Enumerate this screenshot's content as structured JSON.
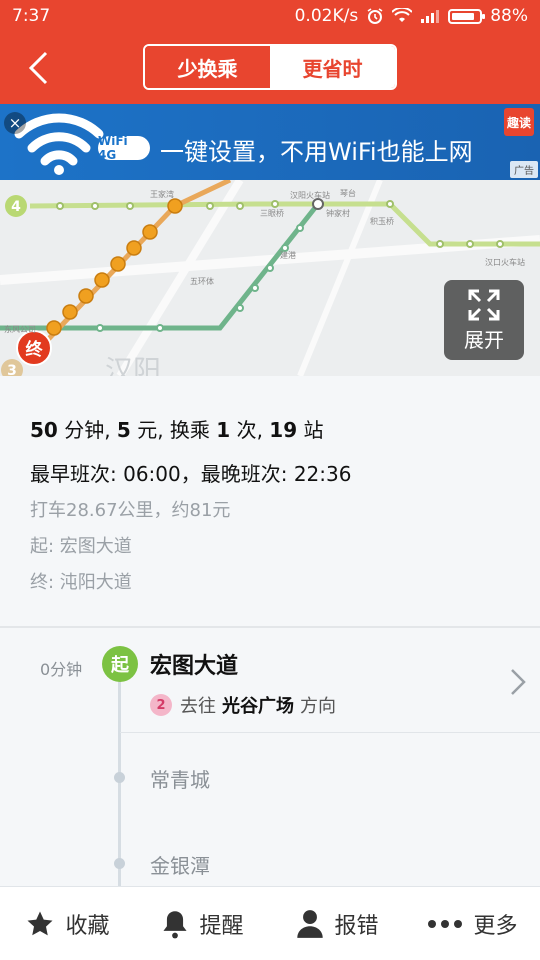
{
  "status_bar": {
    "time": "7:37",
    "speed": "0.02K/s",
    "battery": "88%"
  },
  "header": {
    "tabs": [
      {
        "label": "少换乘",
        "active": true
      },
      {
        "label": "更省时",
        "active": false
      }
    ]
  },
  "ad": {
    "close": "×",
    "pill": "WiFi 4G",
    "text": "一键设置，不用WiFi也能上网",
    "logo": "趣读",
    "tag": "广告"
  },
  "map": {
    "expand_label": "展开",
    "end_badge": "终",
    "line_labels": {
      "line4": "4",
      "line3": "3"
    },
    "stations": [
      "王家湾",
      "汉阳火车站",
      "钟家村",
      "琴台",
      "三眼桥",
      "汉口火车站",
      "东风公司",
      "五环体",
      "建港",
      "积玉桥",
      "展开"
    ],
    "district": "汉阳"
  },
  "summary": {
    "time": "50",
    "time_unit": "分钟",
    "fare": "5",
    "fare_unit": "元",
    "transfer_label": "换乘",
    "transfers": "1",
    "transfer_unit": "次",
    "stations": "19",
    "stations_unit": "站",
    "first_last": "最早班次: 06:00，最晚班次: 22:36",
    "taxi": "打车28.67公里，约81元",
    "start": "起: 宏图大道",
    "end": "终: 沌阳大道"
  },
  "route": {
    "start_time": "0分钟",
    "start_badge": "起",
    "start_station": "宏图大道",
    "line_number": "2",
    "toward_prefix": "去往",
    "toward_station": "光谷广场",
    "toward_suffix": "方向",
    "stops": [
      "常青城",
      "金银潭"
    ]
  },
  "bottom_bar": {
    "favorite": "收藏",
    "remind": "提醒",
    "report": "报错",
    "more": "更多"
  },
  "colors": {
    "brand_red": "#e8452f",
    "start_green": "#7cc243",
    "line2_pink": "#f4b6c9"
  }
}
